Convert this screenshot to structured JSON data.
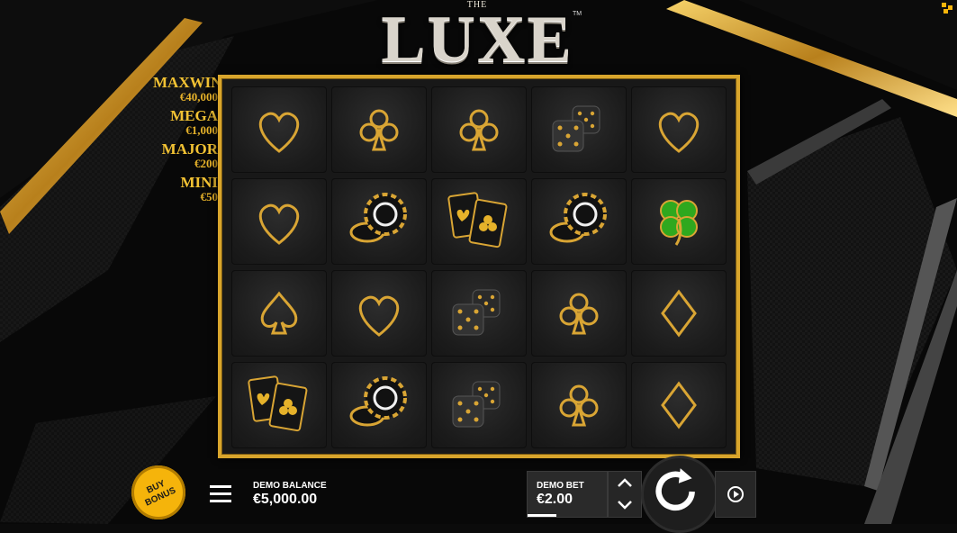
{
  "game": {
    "title_small": "THE",
    "title": "LUXE",
    "trademark": "TM"
  },
  "jackpots": [
    {
      "name": "MAXWIN",
      "value": "€40,000"
    },
    {
      "name": "MEGA",
      "value": "€1,000"
    },
    {
      "name": "MAJOR",
      "value": "€200"
    },
    {
      "name": "MINI",
      "value": "€50"
    }
  ],
  "reels": [
    [
      "heart",
      "club",
      "club",
      "dice",
      "heart"
    ],
    [
      "heart",
      "chips",
      "cards",
      "chips",
      "clover"
    ],
    [
      "spade",
      "heart",
      "dice",
      "club",
      "diamond"
    ],
    [
      "cards",
      "chips",
      "dice",
      "club",
      "diamond"
    ]
  ],
  "buy_bonus": {
    "label": "BUY BONUS"
  },
  "balance": {
    "label": "DEMO BALANCE",
    "value": "€5,000.00"
  },
  "bet": {
    "label": "DEMO BET",
    "value": "€2.00"
  },
  "colors": {
    "gold": "#d8a52c",
    "buy_bonus": "#f5b40b",
    "clover": "#2fa81e"
  },
  "icons": [
    "menu-icon",
    "bet-up-icon",
    "bet-down-icon",
    "spin-icon",
    "autoplay-icon"
  ]
}
